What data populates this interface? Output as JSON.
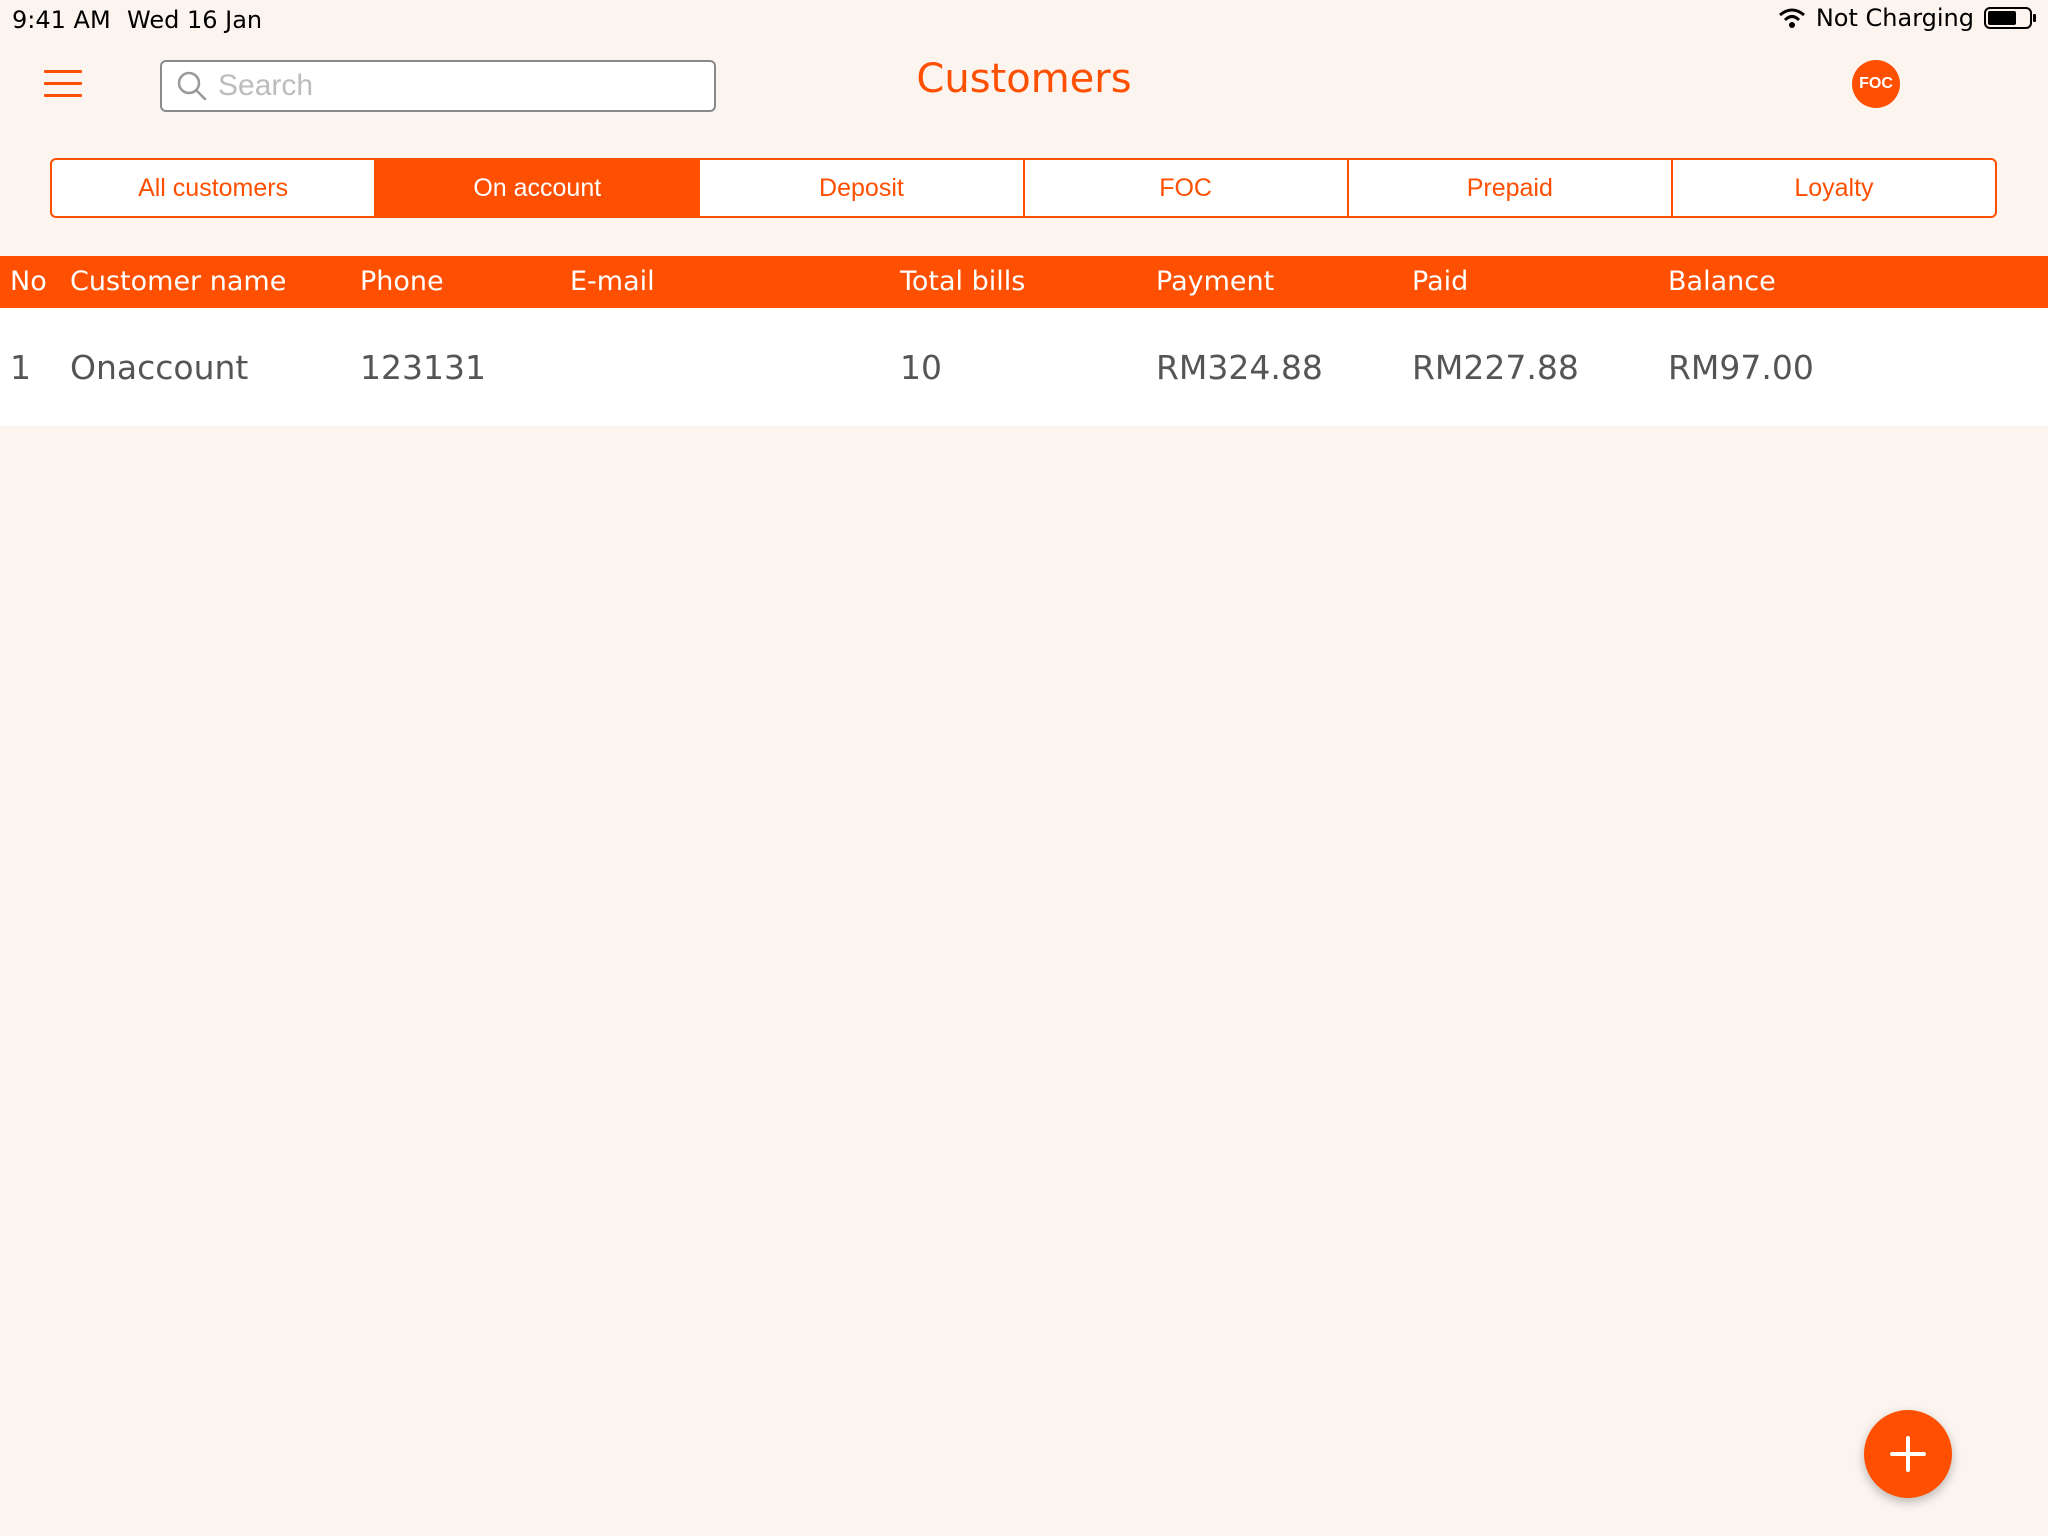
{
  "status_bar": {
    "time": "9:41 AM",
    "date": "Wed 16 Jan",
    "battery_status": "Not Charging"
  },
  "header": {
    "title": "Customers",
    "search_placeholder": "Search",
    "badge": "FOC"
  },
  "tabs": [
    {
      "label": "All customers",
      "active": false
    },
    {
      "label": "On account",
      "active": true
    },
    {
      "label": "Deposit",
      "active": false
    },
    {
      "label": "FOC",
      "active": false
    },
    {
      "label": "Prepaid",
      "active": false
    },
    {
      "label": "Loyalty",
      "active": false
    }
  ],
  "table": {
    "columns": [
      "No",
      "Customer name",
      "Phone",
      "E-mail",
      "Total bills",
      "Payment",
      "Paid",
      "Balance"
    ],
    "rows": [
      {
        "no": "1",
        "name": "Onaccount",
        "phone": "123131",
        "email": "",
        "total_bills": "10",
        "payment": "RM324.88",
        "paid": "RM227.88",
        "balance": "RM97.00"
      }
    ]
  },
  "colors": {
    "accent": "#ff4f00",
    "background": "#fbf4ef"
  },
  "icons": {
    "menu": "hamburger-icon",
    "search": "search-icon",
    "add": "plus-icon",
    "wifi": "wifi-icon",
    "battery": "battery-icon"
  }
}
